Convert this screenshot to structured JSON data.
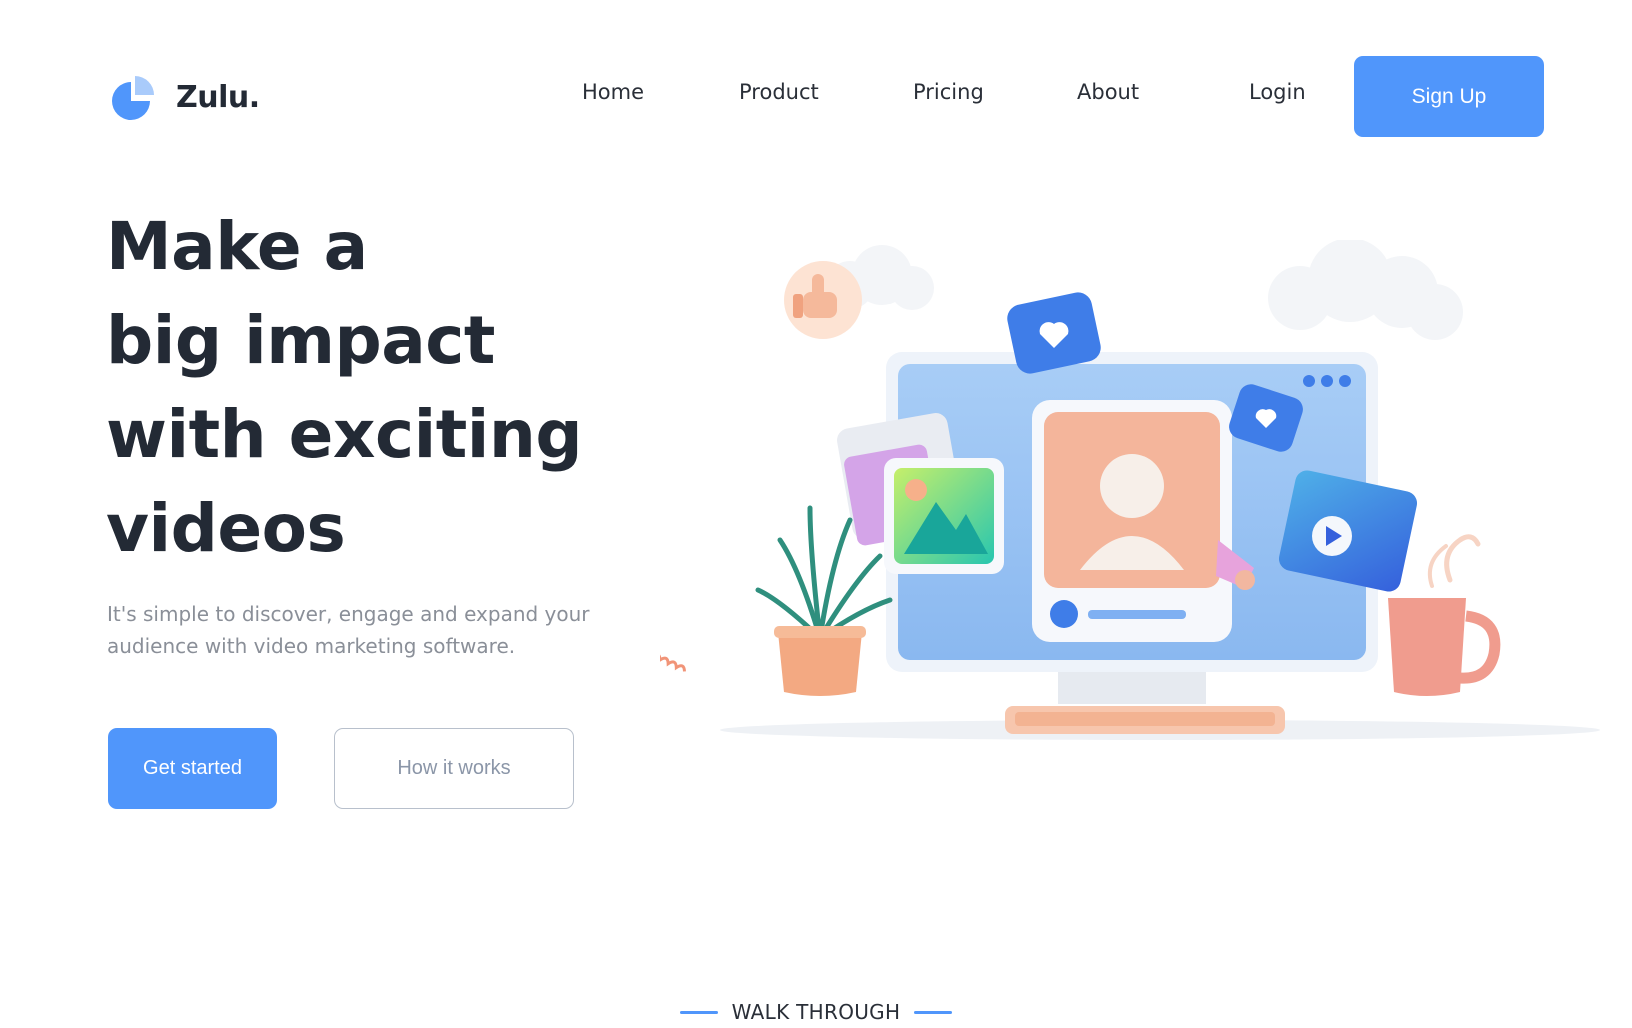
{
  "brand": {
    "name": "Zulu.",
    "logo_icon": "pie-chart-logo",
    "accent_color": "#5096fb"
  },
  "nav": {
    "links": [
      "Home",
      "Product",
      "Pricing",
      "About",
      "Login"
    ],
    "signup_label": "Sign Up"
  },
  "hero": {
    "title_lines": [
      "Make a",
      "big impact",
      "with exciting",
      "videos"
    ],
    "subtitle": "It's simple to discover, engage and expand your audience with video marketing software.",
    "primary_cta": "Get started",
    "secondary_cta": "How it works"
  },
  "illustration": {
    "icons": [
      "thumbs-up-icon",
      "heart-bubble-icon",
      "image-gallery-icon",
      "user-profile-card-icon",
      "video-player-icon",
      "megaphone-icon",
      "plant-icon",
      "mug-icon",
      "keyboard-icon",
      "cloud-icon"
    ]
  },
  "section": {
    "label": "WALK THROUGH"
  }
}
